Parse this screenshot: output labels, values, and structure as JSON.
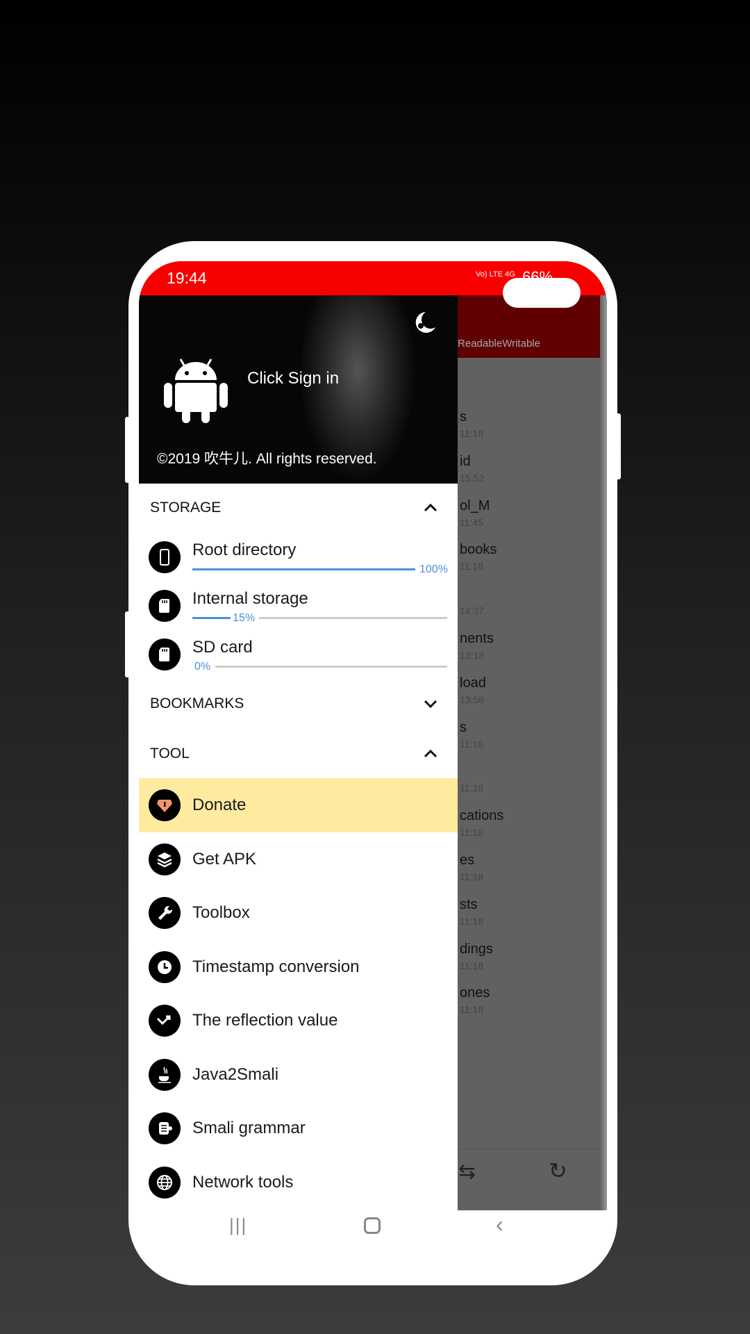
{
  "status_bar": {
    "time": "19:44",
    "network": "Vo) LTE 4G",
    "battery": "66%"
  },
  "header": {
    "sign_in": "Click Sign in",
    "copyright": "©2019 吹牛儿. All rights reserved."
  },
  "toolbar": {
    "subtitle": "ReadableWritable"
  },
  "storage": {
    "title": "STORAGE",
    "items": [
      {
        "label": "Root directory",
        "percent": "100%",
        "fraction": 1.0,
        "icon": "phone-icon"
      },
      {
        "label": "Internal storage",
        "percent": "15%",
        "fraction": 0.15,
        "icon": "sd-card-icon"
      },
      {
        "label": "SD card",
        "percent": "0%",
        "fraction": 0.0,
        "icon": "sd-card-icon"
      }
    ]
  },
  "bookmarks": {
    "title": "BOOKMARKS"
  },
  "tool": {
    "title": "TOOL",
    "items": [
      {
        "label": "Donate",
        "icon": "donate-gem-icon",
        "highlighted": true
      },
      {
        "label": "Get APK",
        "icon": "layers-icon"
      },
      {
        "label": "Toolbox",
        "icon": "wrench-icon"
      },
      {
        "label": "Timestamp conversion",
        "icon": "clock-icon"
      },
      {
        "label": "The reflection value",
        "icon": "trend-icon"
      },
      {
        "label": "Java2Smali",
        "icon": "java-icon"
      },
      {
        "label": "Smali grammar",
        "icon": "smali-icon"
      },
      {
        "label": "Network tools",
        "icon": "globe-icon"
      }
    ]
  },
  "files": [
    {
      "name": "s",
      "date": "11:18"
    },
    {
      "name": "id",
      "date": "15:52"
    },
    {
      "name": "ol_M",
      "date": "11:45"
    },
    {
      "name": "books",
      "date": "11:18"
    },
    {
      "name": "",
      "date": "14:37"
    },
    {
      "name": "nents",
      "date": "13:18"
    },
    {
      "name": "load",
      "date": "13:58"
    },
    {
      "name": "s",
      "date": "11:18"
    },
    {
      "name": "",
      "date": "11:18"
    },
    {
      "name": "cations",
      "date": "11:18"
    },
    {
      "name": "es",
      "date": "11:18"
    },
    {
      "name": "sts",
      "date": "11:18"
    },
    {
      "name": "dings",
      "date": "11:18"
    },
    {
      "name": "ones",
      "date": "11:18"
    }
  ],
  "colors": {
    "status_bar": "#f80000",
    "toolbar": "#600000",
    "accent": "#4a90d9",
    "highlight": "#feeba0"
  }
}
